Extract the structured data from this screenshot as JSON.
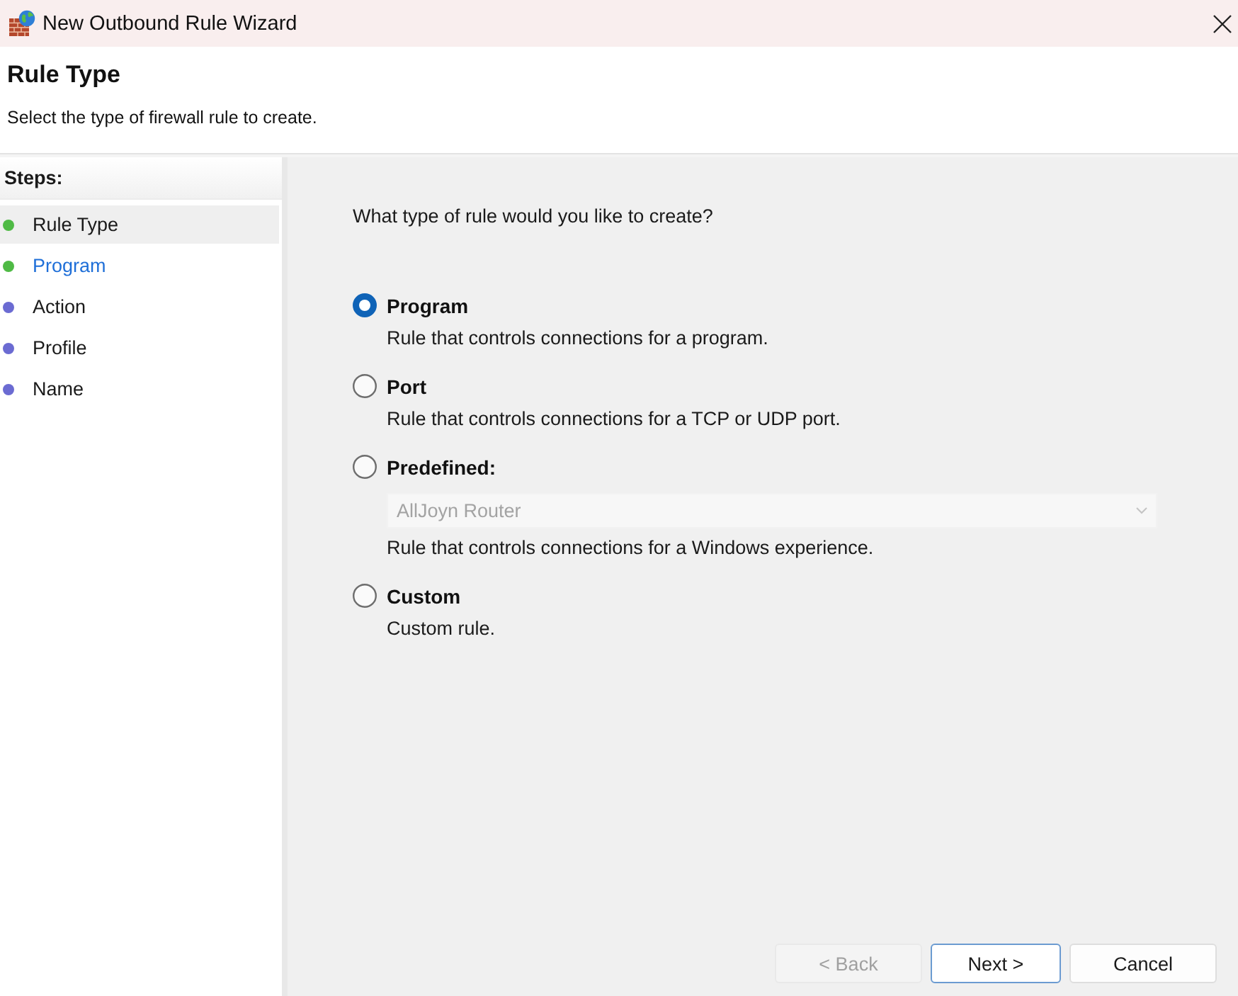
{
  "window": {
    "title": "New Outbound Rule Wizard"
  },
  "header": {
    "title": "Rule Type",
    "subtitle": "Select the type of firewall rule to create."
  },
  "steps": {
    "heading": "Steps:",
    "items": [
      {
        "label": "Rule Type",
        "selected": true,
        "hovered": false,
        "color": "#4fba45"
      },
      {
        "label": "Program",
        "selected": false,
        "hovered": true,
        "color": "#4fba45"
      },
      {
        "label": "Action",
        "selected": false,
        "hovered": false,
        "color": "#6b6bd2"
      },
      {
        "label": "Profile",
        "selected": false,
        "hovered": false,
        "color": "#6b6bd2"
      },
      {
        "label": "Name",
        "selected": false,
        "hovered": false,
        "color": "#6b6bd2"
      }
    ]
  },
  "content": {
    "question": "What type of rule would you like to create?",
    "options": [
      {
        "label": "Program",
        "description": "Rule that controls connections for a program.",
        "selected": true
      },
      {
        "label": "Port",
        "description": "Rule that controls connections for a TCP or UDP port.",
        "selected": false
      },
      {
        "label": "Predefined:",
        "description": "Rule that controls connections for a Windows experience.",
        "selected": false,
        "dropdown": {
          "value": "AllJoyn Router",
          "disabled": true
        }
      },
      {
        "label": "Custom",
        "description": "Custom rule.",
        "selected": false
      }
    ]
  },
  "buttons": [
    {
      "label": "< Back",
      "disabled": true,
      "default": false
    },
    {
      "label": "Next >",
      "disabled": false,
      "default": true
    },
    {
      "label": "Cancel",
      "disabled": false,
      "default": false
    }
  ]
}
